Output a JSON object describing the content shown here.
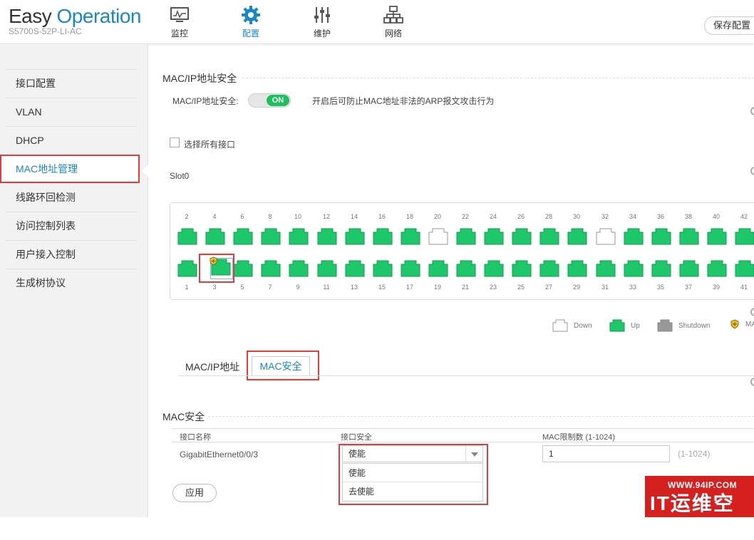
{
  "header": {
    "logo_easy": "Easy",
    "logo_operation": "Operation",
    "model": "S5700S-52P-LI-AC",
    "nav": [
      {
        "label": "监控",
        "icon": "monitor-icon"
      },
      {
        "label": "配置",
        "icon": "gear-icon",
        "active": true
      },
      {
        "label": "维护",
        "icon": "sliders-icon"
      },
      {
        "label": "网络",
        "icon": "network-icon"
      }
    ],
    "save_label": "保存配置"
  },
  "sidebar": {
    "items": [
      {
        "label": "接口配置"
      },
      {
        "label": "VLAN"
      },
      {
        "label": "DHCP"
      },
      {
        "label": "MAC地址管理",
        "active": true
      },
      {
        "label": "线路环回检测"
      },
      {
        "label": "访问控制列表"
      },
      {
        "label": "用户接入控制"
      },
      {
        "label": "生成树协议"
      }
    ]
  },
  "mac_ip_security": {
    "title": "MAC/IP地址安全",
    "field_label": "MAC/IP地址安全:",
    "toggle_label": "ON",
    "description": "开启后可防止MAC地址非法的ARP报文攻击行为"
  },
  "select_all_label": "选择所有接口",
  "slot_label": "Slot0",
  "ports": {
    "top_numbers": [
      "2",
      "4",
      "6",
      "8",
      "10",
      "12",
      "14",
      "16",
      "18",
      "20",
      "22",
      "24",
      "26",
      "28",
      "30",
      "32",
      "34",
      "36",
      "38",
      "40",
      "42"
    ],
    "bottom_numbers": [
      "1",
      "3",
      "5",
      "7",
      "9",
      "11",
      "13",
      "15",
      "17",
      "19",
      "21",
      "23",
      "25",
      "27",
      "29",
      "31",
      "33",
      "35",
      "37",
      "39",
      "41"
    ],
    "top_down": [
      "20",
      "32"
    ],
    "bottom_down": [],
    "secured": [
      "3"
    ],
    "selected": [
      "3"
    ]
  },
  "legend": {
    "down": "Down",
    "up": "Up",
    "shutdown": "Shutdown",
    "mac_secure": "MA"
  },
  "colors": {
    "up": "#1ec86a",
    "down": "#ffffff",
    "shutdown": "#999999",
    "accent": "#1a87c9",
    "highlight": "#e23c3c"
  },
  "tabs": {
    "tab1": "MAC/IP地址",
    "tab2": "MAC安全"
  },
  "mac_security": {
    "title": "MAC安全",
    "columns": [
      "接口名称",
      "接口安全",
      "MAC限制数 (1-1024)"
    ],
    "row": {
      "interface": "GigabitEthernet0/0/3",
      "security_value": "使能",
      "limit_value": "1",
      "limit_hint": "(1-1024)"
    },
    "dropdown_options": [
      "使能",
      "去使能"
    ],
    "apply_label": "应用"
  },
  "watermark": {
    "url": "WWW.94IP.COM",
    "main": "IT运维空间"
  }
}
